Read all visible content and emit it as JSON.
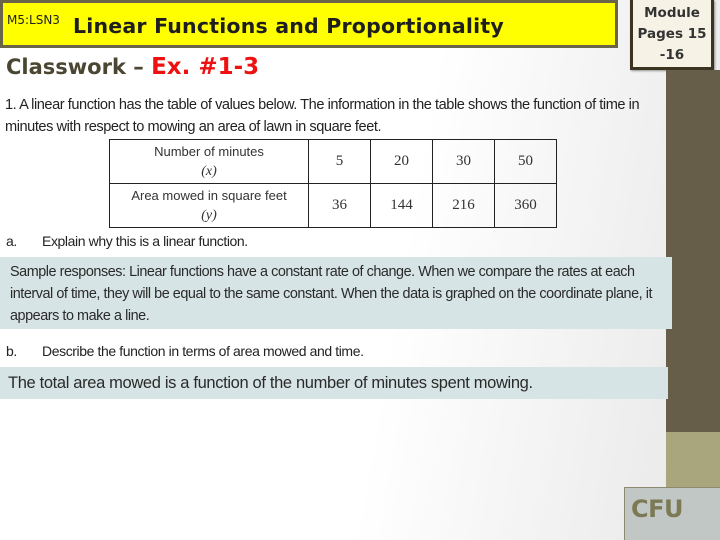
{
  "header": {
    "lesson_code": "M5:LSN3",
    "title": "Linear Functions and Proportionality"
  },
  "module_ref": {
    "line1": "Module",
    "line2": "Pages 15",
    "line3": "-16"
  },
  "subtitle": {
    "prefix": "Classwork – ",
    "exercise": "Ex. #1-3"
  },
  "problem": {
    "text": "1. A linear function has the table of values below.  The information in the table shows the function of time in minutes with respect to mowing an area of lawn in square feet."
  },
  "table": {
    "rows": [
      {
        "label": "Number of minutes",
        "variable": "(x)",
        "values": [
          "5",
          "20",
          "30",
          "50"
        ]
      },
      {
        "label": "Area mowed in square feet",
        "variable": "(y)",
        "values": [
          "36",
          "144",
          "216",
          "360"
        ]
      }
    ]
  },
  "questions": [
    {
      "letter": "a.",
      "prompt": "Explain why this is a linear function.",
      "answer": "Sample responses: Linear functions have a constant rate of change.  When we compare the rates at each interval of time, they will be equal to the same constant.  When the data is graphed on the coordinate plane, it appears to make a line."
    },
    {
      "letter": "b.",
      "prompt": "Describe the function in terms of area mowed and time.",
      "answer": "The total area mowed is a function of the number of minutes spent mowing."
    }
  ],
  "cfu": {
    "label": "CFU"
  },
  "colors": {
    "header_bg": "#ffff00",
    "header_border": "#6b6547",
    "exercise_red": "#ee1111",
    "sidebar_dark": "#665e48",
    "sidebar_khaki": "#a9a57d",
    "answer_bg": "#d7e4e5",
    "cfu_bg": "#c1c7c5"
  }
}
